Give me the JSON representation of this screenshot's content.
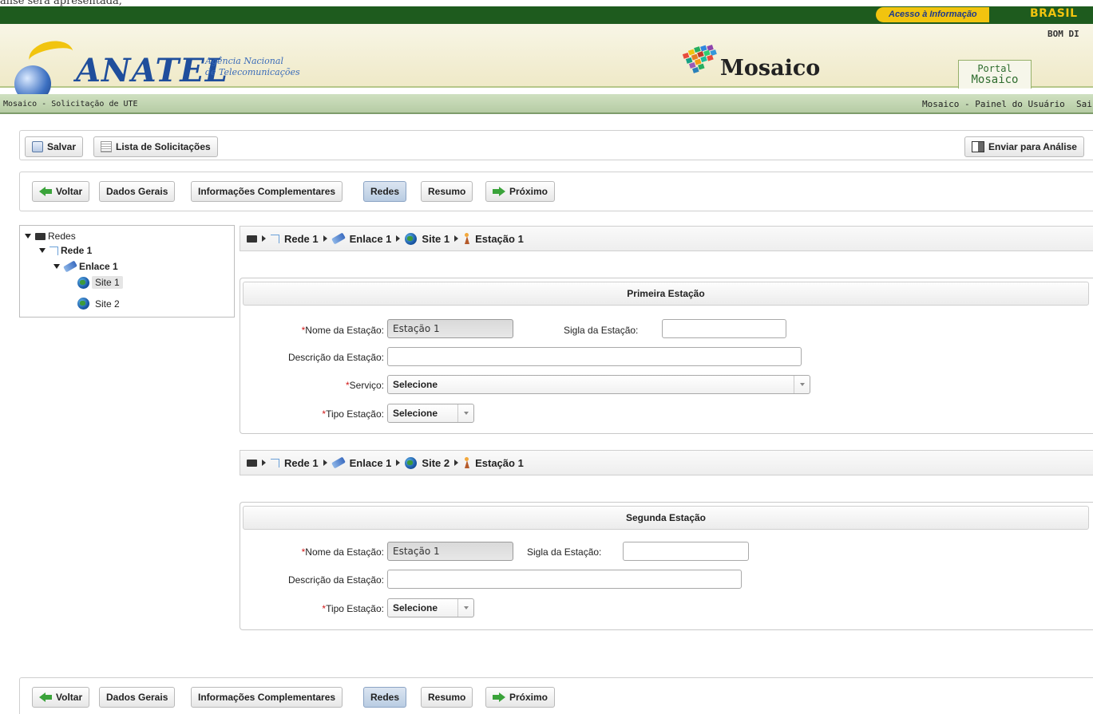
{
  "top_cut_text": "álise será apresentada,",
  "gov_bar": {
    "acesso": "Acesso à Informação",
    "brasil": "BRASIL"
  },
  "header": {
    "greeting": "BOM DI",
    "logo_text": "ANATEL",
    "logo_sub_line1": "Agência Nacional",
    "logo_sub_line2": "de Telecomunicações",
    "app_title": "Mosaico",
    "portal_line1": "Portal",
    "portal_line2": "Mosaico"
  },
  "nav": {
    "left": "Mosaico - Solicitação de UTE",
    "right": "Mosaico - Painel do Usuário",
    "sair": "Sai"
  },
  "toolbar": {
    "save": "Salvar",
    "list": "Lista de Solicitações",
    "send": "Enviar para Análise"
  },
  "steps": {
    "back": "Voltar",
    "tabs": [
      "Dados Gerais",
      "Informações Complementares",
      "Redes",
      "Resumo"
    ],
    "active_tab": "Redes",
    "next": "Próximo"
  },
  "tree": {
    "root": "Redes",
    "rede": "Rede 1",
    "enlace": "Enlace 1",
    "sites": [
      "Site 1",
      "Site 2"
    ],
    "selected": "Site 1"
  },
  "station1": {
    "breadcrumb": [
      "Rede 1",
      "Enlace 1",
      "Site 1",
      "Estação 1"
    ],
    "legend": "Primeira Estação",
    "name_label": "Nome da Estação:",
    "name_value": "Estação 1",
    "sigla_label": "Sigla da Estação:",
    "sigla_value": "",
    "desc_label": "Descrição da Estação:",
    "desc_value": "",
    "servico_label": "Serviço:",
    "servico_value": "Selecione",
    "tipo_label": "Tipo Estação:",
    "tipo_value": "Selecione"
  },
  "station2": {
    "breadcrumb": [
      "Rede 1",
      "Enlace 1",
      "Site 2",
      "Estação 1"
    ],
    "legend": "Segunda Estação",
    "name_label": "Nome da Estação:",
    "name_value": "Estação 1",
    "sigla_label": "Sigla da Estação:",
    "sigla_value": "",
    "desc_label": "Descrição da Estação:",
    "desc_value": "",
    "tipo_label": "Tipo Estação:",
    "tipo_value": "Selecione"
  },
  "colors": {
    "gov_green": "#1e5b1e",
    "accent_yellow": "#f1c40f",
    "brand_blue": "#1f4e9c",
    "required": "#d01818"
  }
}
